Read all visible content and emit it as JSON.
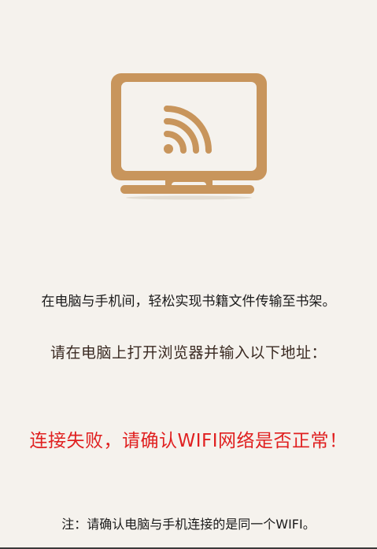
{
  "icon": {
    "name": "wifi-monitor-icon",
    "color": "#c8955c"
  },
  "texts": {
    "description": "在电脑与手机间，轻松实现书籍文件传输至书架。",
    "instruction": "请在电脑上打开浏览器并输入以下地址：",
    "error": "连接失败，请确认WIFI网络是否正常！",
    "note": "注：请确认电脑与手机连接的是同一个WIFI。"
  },
  "colors": {
    "background": "#f5f2ed",
    "error": "#e02020",
    "accent": "#c8955c"
  }
}
